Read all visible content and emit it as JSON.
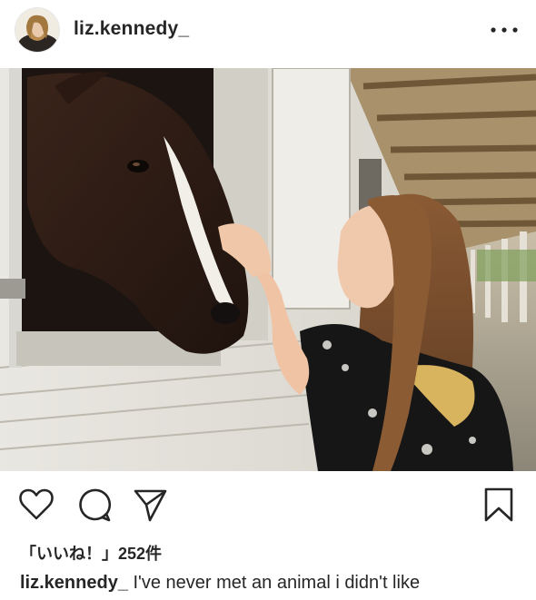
{
  "post": {
    "username": "liz.kennedy_",
    "likes_text": "「いいね！」252件",
    "caption": {
      "username": "liz.kennedy_",
      "text": "I've never met an animal i didn't like"
    }
  },
  "icons": {
    "more": "more-horizontal-icon",
    "like": "heart-icon",
    "comment": "comment-bubble-icon",
    "share": "paper-plane-icon",
    "save": "bookmark-icon"
  },
  "colors": {
    "text": "#262626",
    "background": "#ffffff"
  }
}
